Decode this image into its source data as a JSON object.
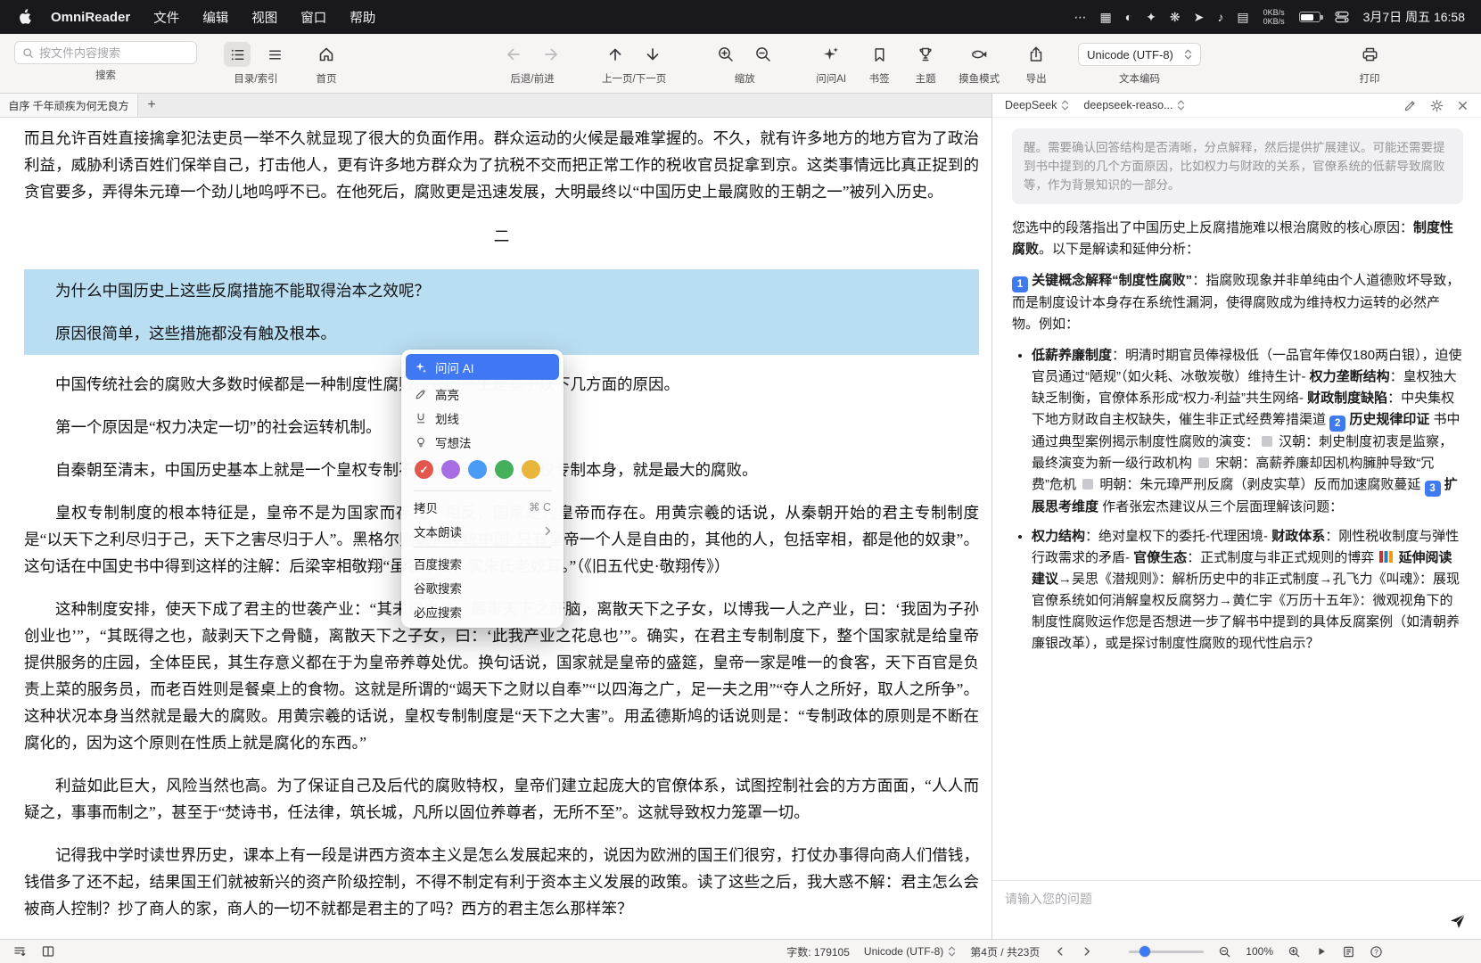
{
  "menubar": {
    "app_name": "OmniReader",
    "menus": [
      "文件",
      "编辑",
      "视图",
      "窗口",
      "帮助"
    ],
    "status_icons": [
      {
        "name": "more-icon",
        "glyph": "⋯"
      },
      {
        "name": "screen-mirror-icon",
        "glyph": "▦"
      },
      {
        "name": "app-icon-assistant",
        "glyph": "◐"
      },
      {
        "name": "app-icon-launcher",
        "glyph": "✦"
      },
      {
        "name": "app-icon-ai",
        "glyph": "❋"
      },
      {
        "name": "app-icon-messenger",
        "glyph": "➤"
      },
      {
        "name": "app-icon-music",
        "glyph": "♪"
      },
      {
        "name": "app-icon-stats",
        "glyph": "▤"
      }
    ],
    "network_up": "0KB/s",
    "network_down": "0KB/s",
    "datetime": "3月7日 周五 16:58"
  },
  "toolbar": {
    "search": {
      "placeholder": "按文件内容搜索",
      "label": "搜索"
    },
    "toc": {
      "label": "目录/索引"
    },
    "home": {
      "label": "首页"
    },
    "history": {
      "label": "后退/前进"
    },
    "paging": {
      "label": "上一页/下一页"
    },
    "zoom": {
      "label": "缩放"
    },
    "ask_ai": {
      "label": "问问AI"
    },
    "bookmark": {
      "label": "书签"
    },
    "theme": {
      "label": "主题"
    },
    "fish_mode": {
      "label": "摸鱼模式"
    },
    "export": {
      "label": "导出"
    },
    "encoding": {
      "label": "文本编码",
      "value": "Unicode (UTF-8)"
    },
    "print": {
      "label": "打印"
    }
  },
  "tabs": {
    "active": "自序 千年顽疾为何无良方",
    "add": "+"
  },
  "document": {
    "paragraphs": [
      {
        "text": "而且允许百姓直接擒拿犯法吏员一举不久就显现了很大的负面作用。群众运动的火候是最难掌握的。不久，就有许多地方的地方官为了政治利益，威胁利诱百姓们保举自己，打击他人，更有许多地方群众为了抗税不交而把正常工作的税收官员捉拿到京。这类事情远比真正捉到的贪官要多，弄得朱元璋一个劲儿地呜呼不已。在他死后，腐败更是迅速发展，大明最终以“中国历史上最腐败的王朝之一”被列入历史。",
        "indent": false
      },
      {
        "text": "二",
        "center": true
      },
      {
        "text": "为什么中国历史上这些反腐措施不能取得治本之效呢？",
        "indent": true,
        "highlight": true
      },
      {
        "text": "原因很简单，这些措施都没有触及根本。",
        "indent": true,
        "highlight": true
      },
      {
        "text": "中国传统社会的腐败大多数时候都是一种制度性腐败，它的产生是基于以下几方面的原因。",
        "indent": true
      },
      {
        "text": "第一个原因是“权力决定一切”的社会运转机制。",
        "indent": true
      },
      {
        "text": "自秦朝至清末，中国历史基本上就是一个皇权专制不断强化的历史。皇权专制本身，就是最大的腐败。",
        "indent": true
      },
      {
        "text": "皇权专制制度的根本特征是，皇帝不是为国家而存在，相反，国家是为皇帝而存在。用黄宗羲的话说，从秦朝开始的君主专制制度是“以天下之利尽归于己，天下之害尽归于人”。黑格尔则说，传统中国“只有皇帝一个人是自由的，其他的人，包括宰相，都是他的奴隶”。这句话在中国史书中得到这样的注解：后梁宰相敬翔“虽名宰相，实朱氏老奴耳。”（《旧五代史·敬翔传》）",
        "indent": true
      },
      {
        "text": "这种制度安排，使天下成了君主的世袭产业：“其未得之也，屠毒天下之肝脑，离散天下之子女，以博我一人之产业，曰：‘我固为子孙创业也’”，“其既得之也，敲剥天下之骨髓，离散天下之子女，曰：‘此我产业之花息也’”。确实，在君主专制制度下，整个国家就是给皇帝提供服务的庄园，全体臣民，其生存意义都在于为皇帝养尊处优。换句话说，国家就是皇帝的盛筵，皇帝一家是唯一的食客，天下百官是负责上菜的服务员，而老百姓则是餐桌上的食物。这就是所谓的“竭天下之财以自奉”“以四海之广，足一夫之用”“夺人之所好，取人之所争”。这种状况本身当然就是最大的腐败。用黄宗羲的话说，皇权专制制度是“天下之大害”。用孟德斯鸠的话说则是：“专制政体的原则是不断在腐化的，因为这个原则在性质上就是腐化的东西。”",
        "indent": true
      },
      {
        "text": "利益如此巨大，风险当然也高。为了保证自己及后代的腐败特权，皇帝们建立起庞大的官僚体系，试图控制社会的方方面面，“人人而疑之，事事而制之”，甚至于“焚诗书，任法律，筑长城，凡所以固位养尊者，无所不至”。这就导致权力笼罩一切。",
        "indent": true
      },
      {
        "text": "记得我中学时读世界历史，课本上有一段是讲西方资本主义是怎么发展起来的，说因为欧洲的国王们很穷，打仗办事得向商人们借钱，钱借多了还不起，结果国王们就被新兴的资产阶级控制，不得不制定有利于资本主义发展的政策。读了这些之后，我大惑不解：君主怎么会被商人控制？抄了商人的家，商人的一切不就都是君主的了吗？西方的君主怎么那样笨？",
        "indent": true
      }
    ]
  },
  "context_menu": {
    "ask_ai": "问问 AI",
    "annotate_items": [
      "高亮",
      "划线",
      "写想法"
    ],
    "colors": [
      "#e4574e",
      "#a66de4",
      "#4a9bf5",
      "#44b05b",
      "#e9b63c"
    ],
    "selected_color_index": 0,
    "copy": {
      "label": "拷贝",
      "shortcut": "⌘ C"
    },
    "speech": {
      "label": "文本朗读"
    },
    "search_items": [
      "百度搜索",
      "谷歌搜索",
      "必应搜索"
    ]
  },
  "ai_panel": {
    "provider": "DeepSeek",
    "model": "deepseek-reaso...",
    "reasoning_quote": "醒。需要确认回答结构是否清晰，分点解释，然后提供扩展建议。可能还需要提到书中提到的几个方面原因，比如权力与财政的关系，官僚系统的低薪导致腐败等，作为背景知识的一部分。",
    "intro_html": "您选中的段落指出了中国历史上反腐措施难以根治腐败的核心原因：<b>制度性腐败</b>。以下是解读和延伸分析：",
    "concept_html": "<span class=\"nb\">1</span> <b>关键概念解释“制度性腐败”</b>：指腐败现象并非单纯由个人道德败坏导致，而是制度设计本身存在系统性漏洞，使得腐败成为维持权力运转的必然产物。例如：",
    "bullets": [
      {
        "html": "<b>低薪养廉制度</b>：明清时期官员俸禄极低（一品官年俸仅180两白银），迫使官员通过“陋规”（如火耗、冰敬炭敬）维持生计- <b>权力垄断结构</b>：皇权独大缺乏制衡，官僚体系形成“权力-利益”共生网络- <b>财政制度缺陷</b>：中央集权下地方财政自主权缺失，催生非正式经费筹措渠道 <span class=\"nb\">2</span> <b>历史规律印证</b> 书中通过典型案例揭示制度性腐败的演变：<span class=\"gs\"></span> 汉朝：刺史制度初衷是监察，最终演变为新一级行政机构 <span class=\"gs\"></span> 宋朝：高薪养廉却因机构臃肿导致“冗费”危机 <span class=\"gs\"></span> 明朝：朱元璋严刑反腐（剥皮实草）反而加速腐败蔓延 <span class=\"nb\">3</span> <b>扩展思考维度</b> 作者张宏杰建议从三个层面理解该问题："
      },
      {
        "html": "<b>权力结构</b>：绝对皇权下的委托-代理困境- <b>财政体系</b>：刚性税收制度与弹性行政需求的矛盾- <b>官僚生态</b>：正式制度与非正式规则的博弈 <span class=\"books\"></span> <b>延伸阅读建议</b>→吴思《潜规则》：解析历史中的非正式制度→孔飞力《叫魂》：展现官僚系统如何消解皇权反腐努力→黄仁宇《万历十五年》：微观视角下的制度性腐败运作您是否想进一步了解书中提到的具体反腐案例（如清朝养廉银改革），或是探讨制度性腐败的现代性启示？"
      }
    ],
    "input_placeholder": "请输入您的问题"
  },
  "statusbar": {
    "word_count": "字数: 179105",
    "encoding": "Unicode (UTF-8)",
    "page_info": "第4页 / 共23页",
    "zoom_percent": "100%"
  }
}
